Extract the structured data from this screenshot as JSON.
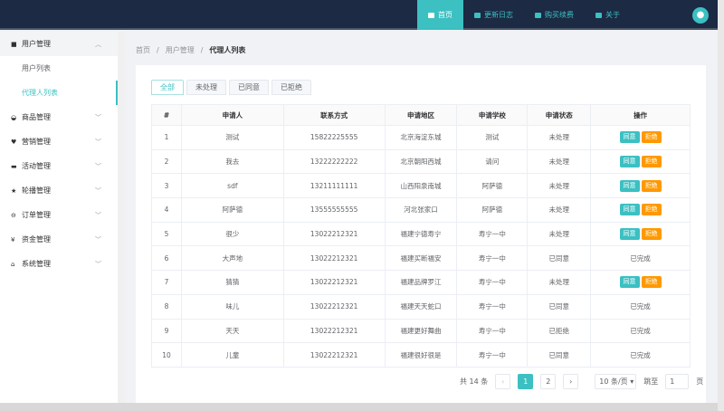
{
  "topnav": [
    {
      "label": "首页",
      "icon": "monitor-icon"
    },
    {
      "label": "更新日志",
      "icon": "dot-icon"
    },
    {
      "label": "购买续费",
      "icon": "half-circle-icon"
    },
    {
      "label": "关于",
      "icon": "book-icon"
    }
  ],
  "sidebar": {
    "open_group": "用户管理",
    "sub_items": [
      "用户列表",
      "代理人列表"
    ],
    "groups": [
      {
        "label": "商品管理",
        "glyph": "◒"
      },
      {
        "label": "营销管理",
        "glyph": "♥"
      },
      {
        "label": "活动管理",
        "glyph": "▬"
      },
      {
        "label": "轮播管理",
        "glyph": "★"
      },
      {
        "label": "订单管理",
        "glyph": "⊖"
      },
      {
        "label": "资金管理",
        "glyph": "¥"
      },
      {
        "label": "系统管理",
        "glyph": "⌂"
      }
    ]
  },
  "breadcrumb": [
    "首页",
    "用户管理",
    "代理人列表"
  ],
  "tabs": [
    "全部",
    "未处理",
    "已同意",
    "已拒绝"
  ],
  "table": {
    "headers": [
      "#",
      "申请人",
      "联系方式",
      "申请地区",
      "申请学校",
      "申请状态",
      "操作"
    ],
    "rows": [
      [
        "1",
        "测试",
        "15822225555",
        "北京海淀东城",
        "测试",
        "未处理",
        ""
      ],
      [
        "2",
        "我去",
        "13222222222",
        "北京朝阳西城",
        "请问",
        "未处理",
        ""
      ],
      [
        "3",
        "sdf",
        "13211111111",
        "山西阳泉南城",
        "阿萨德",
        "未处理",
        ""
      ],
      [
        "4",
        "阿萨德",
        "13555555555",
        "河北张家口",
        "阿萨德",
        "未处理",
        ""
      ],
      [
        "5",
        "很少",
        "13022212321",
        "福建宁德寿宁",
        "寿宁一中",
        "未处理",
        ""
      ],
      [
        "6",
        "大声地",
        "13022212321",
        "福建买断福安",
        "寿宁一中",
        "已同意",
        "已完成"
      ],
      [
        "7",
        "猜猜",
        "13022212321",
        "福建品牌罗江",
        "寿宁一中",
        "未处理",
        ""
      ],
      [
        "8",
        "味儿",
        "13022212321",
        "福建天天蛇口",
        "寿宁一中",
        "已同意",
        "已完成"
      ],
      [
        "9",
        "天天",
        "13022212321",
        "福建更好舞曲",
        "寿宁一中",
        "已拒绝",
        "已完成"
      ],
      [
        "10",
        "儿童",
        "13022212321",
        "福建很好很是",
        "寿宁一中",
        "已同意",
        "已完成"
      ]
    ],
    "agree": "同意",
    "reject": "拒绝"
  },
  "pagination": {
    "total": "共 14 条",
    "pages": [
      "1",
      "2"
    ],
    "current": "1",
    "page_size": "10 条/页",
    "jump_label": "跳至",
    "jump_value": "1",
    "page_suffix": "页"
  }
}
